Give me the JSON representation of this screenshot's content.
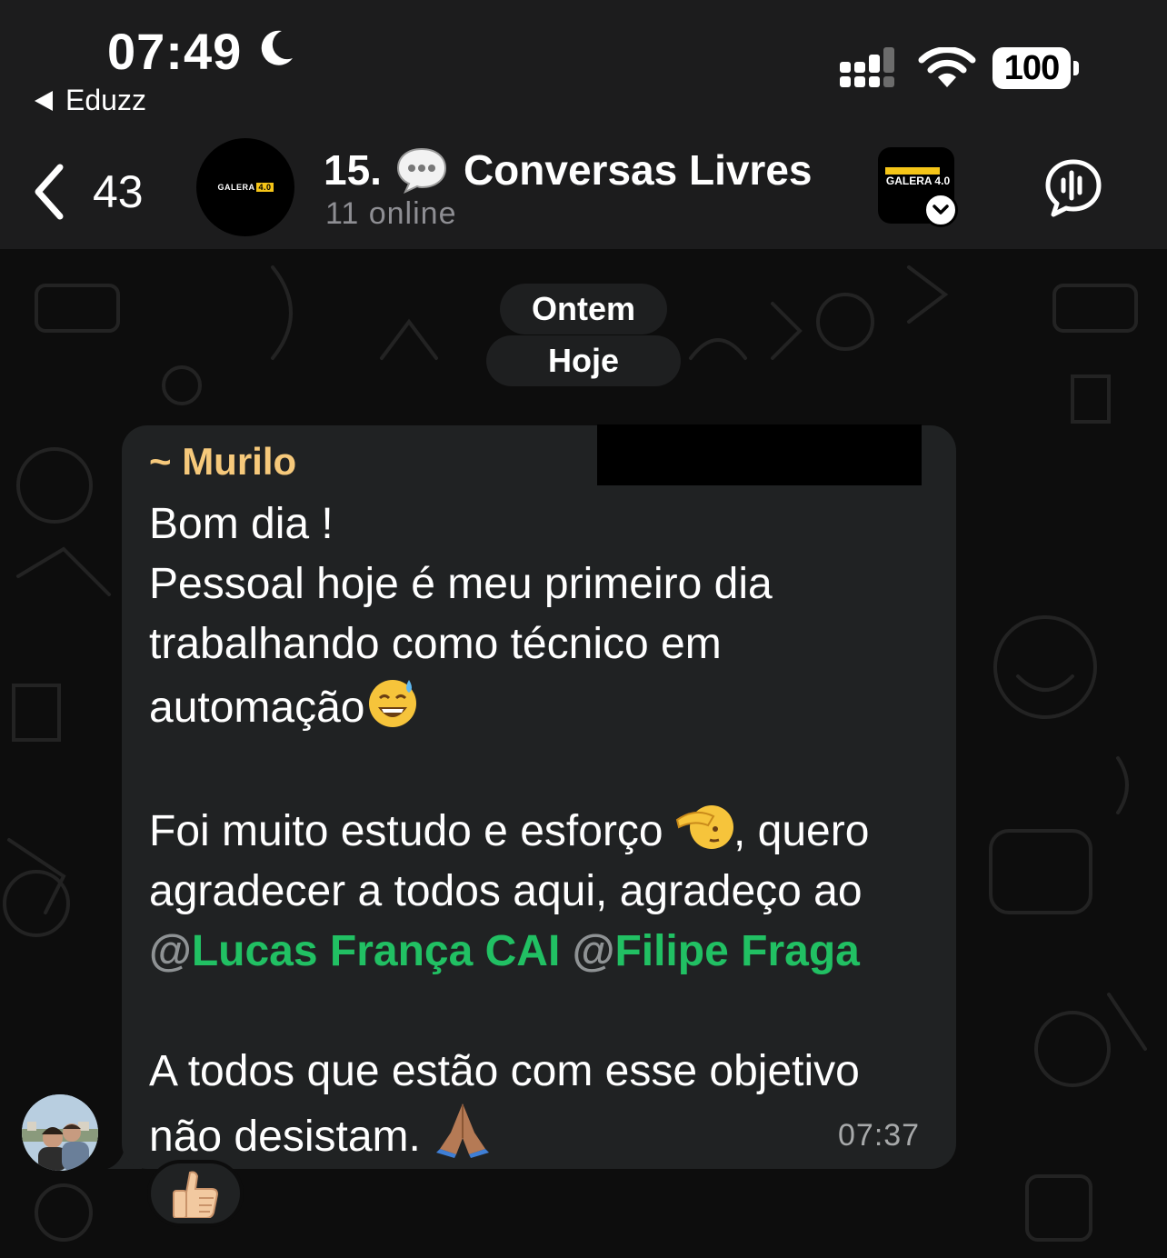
{
  "status_bar": {
    "time": "07:49",
    "back_app": "Eduzz",
    "battery": "100",
    "icons": [
      "moon-icon",
      "signal-icon",
      "wifi-icon",
      "battery-icon"
    ]
  },
  "header": {
    "unread_count": "43",
    "title_prefix": "15.",
    "title_name": "Conversas Livres",
    "subtitle": "11 online",
    "group_avatar_text": "GALERA",
    "group_avatar_badge": "4.0",
    "community_name": "GALERA 4.0",
    "icons": [
      "chevron-left-icon",
      "speech-bubble-icon",
      "chevron-down-icon",
      "voice-chat-icon"
    ]
  },
  "chat": {
    "date_pills": [
      "Ontem",
      "Hoje"
    ],
    "message": {
      "sender": "~ Murilo",
      "line1": "Bom dia !",
      "line2": "Pessoal hoje é meu primeiro dia",
      "line3": "trabalhando como técnico em",
      "line4": "automação",
      "line5a": "Foi muito estudo e esforço ",
      "line5b": ", quero",
      "line6": "agradecer a todos aqui, agradeço ao",
      "mention1": "Lucas França CAI",
      "mention2": "Filipe Fraga",
      "line7": "A todos que estão com esse objetivo",
      "line8": "não desistam. ",
      "time": "07:37",
      "reaction": "👍🏼",
      "emojis": [
        "sweat-smile-emoji",
        "saluting-face-emoji",
        "folded-hands-emoji"
      ]
    }
  },
  "colors": {
    "background": "#0d0d0d",
    "header": "#1c1c1d",
    "bubble": "#202223",
    "sender": "#f6c97b",
    "mention": "#21c063",
    "muted": "#8e8e93"
  }
}
